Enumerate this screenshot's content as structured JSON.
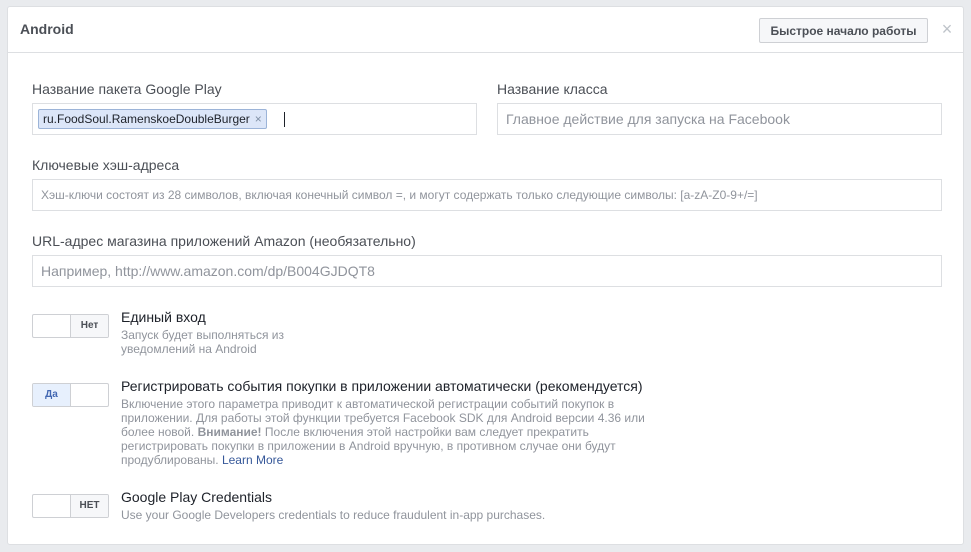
{
  "header": {
    "title": "Android",
    "quick_start_label": "Быстрое начало работы",
    "close_icon": "×"
  },
  "package_name": {
    "label": "Название пакета Google Play",
    "token_value": "ru.FoodSoul.RamenskoeDoubleBurger",
    "token_remove": "×"
  },
  "class_name": {
    "label": "Название класса",
    "placeholder": "Главное действие для запуска на Facebook"
  },
  "key_hashes": {
    "label": "Ключевые хэш-адреса",
    "placeholder": "Хэш-ключи состоят из 28 символов, включая конечный символ =, и могут содержать только следующие символы: [a-zA-Z0-9+/=]"
  },
  "amazon_url": {
    "label": "URL-адрес магазина приложений Amazon (необязательно)",
    "placeholder": "Например, http://www.amazon.com/dp/B004GJDQT8"
  },
  "settings": {
    "single_sign_on": {
      "toggle_label": "Нет",
      "title": "Единый вход",
      "desc_line1": "Запуск будет выполняться из",
      "desc_line2": "уведомлений на Android"
    },
    "log_purchases": {
      "toggle_label": "Да",
      "title": "Регистрировать события покупки в приложении автоматически (рекомендуется)",
      "desc_line1": "Включение этого параметра приводит к автоматической регистрации событий покупок в",
      "desc_line2": "приложении. Для работы этой функции требуется Facebook SDK для Android версии 4.36 или",
      "desc_line3_pre": "более новой.",
      "desc_line3_bold": "Внимание!",
      "desc_line3_post": "После включения этой настройки вам следует прекратить",
      "desc_line4": "регистрировать покупки в приложении в Android вручную, в противном случае они будут",
      "desc_line5": "продублированы.",
      "learn_more": "Learn More"
    },
    "play_credentials": {
      "toggle_label": "НЕТ",
      "title": "Google Play Credentials",
      "desc": "Use your Google Developers credentials to reduce fraudulent in-app purchases."
    }
  }
}
